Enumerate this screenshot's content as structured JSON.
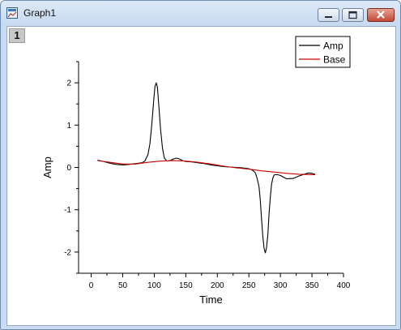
{
  "window": {
    "title": "Graph1",
    "layer_label": "1"
  },
  "icons": {
    "app": "graph-window-icon",
    "minimize": "minimize-icon",
    "maximize": "maximize-icon",
    "close": "close-icon"
  },
  "colors": {
    "amp": "#000000",
    "base": "#cc0000"
  },
  "chart_data": {
    "type": "line",
    "xlabel": "Time",
    "ylabel": "Amp",
    "xlim": [
      -20,
      400
    ],
    "ylim": [
      -2.5,
      2.5
    ],
    "xticks": [
      0,
      50,
      100,
      150,
      200,
      250,
      300,
      350,
      400
    ],
    "yticks": [
      -2,
      -1,
      0,
      1,
      2
    ],
    "legend": {
      "placement": "top-right"
    },
    "series": [
      {
        "name": "Amp",
        "x": [
          10,
          20,
          30,
          40,
          50,
          60,
          70,
          80,
          85,
          90,
          93,
          96,
          99,
          101,
          103,
          105,
          107,
          110,
          113,
          116,
          120,
          125,
          130,
          135,
          140,
          145,
          150,
          160,
          170,
          180,
          190,
          200,
          210,
          220,
          230,
          240,
          250,
          255,
          260,
          263,
          266,
          268,
          270,
          272,
          274,
          276,
          278,
          280,
          282,
          284,
          286,
          288,
          290,
          292,
          295,
          300,
          310,
          320,
          330,
          340,
          345,
          350,
          355
        ],
        "y": [
          0.17,
          0.14,
          0.1,
          0.07,
          0.06,
          0.07,
          0.09,
          0.11,
          0.15,
          0.3,
          0.55,
          1.0,
          1.55,
          1.9,
          2.0,
          1.9,
          1.5,
          0.9,
          0.45,
          0.22,
          0.15,
          0.16,
          0.2,
          0.22,
          0.2,
          0.16,
          0.14,
          0.13,
          0.11,
          0.09,
          0.06,
          0.04,
          0.02,
          0.01,
          0.0,
          -0.01,
          -0.03,
          -0.06,
          -0.12,
          -0.25,
          -0.45,
          -0.75,
          -1.2,
          -1.6,
          -1.9,
          -2.02,
          -1.9,
          -1.6,
          -1.1,
          -0.7,
          -0.4,
          -0.25,
          -0.18,
          -0.17,
          -0.17,
          -0.19,
          -0.27,
          -0.26,
          -0.2,
          -0.15,
          -0.13,
          -0.14,
          -0.16
        ]
      },
      {
        "name": "Base",
        "x": [
          10,
          30,
          50,
          70,
          90,
          110,
          130,
          150,
          170,
          190,
          210,
          230,
          250,
          270,
          290,
          310,
          330,
          350,
          355
        ],
        "y": [
          0.16,
          0.12,
          0.08,
          0.08,
          0.12,
          0.15,
          0.16,
          0.15,
          0.12,
          0.08,
          0.03,
          -0.01,
          -0.04,
          -0.08,
          -0.11,
          -0.14,
          -0.16,
          -0.17,
          -0.17
        ]
      }
    ]
  }
}
